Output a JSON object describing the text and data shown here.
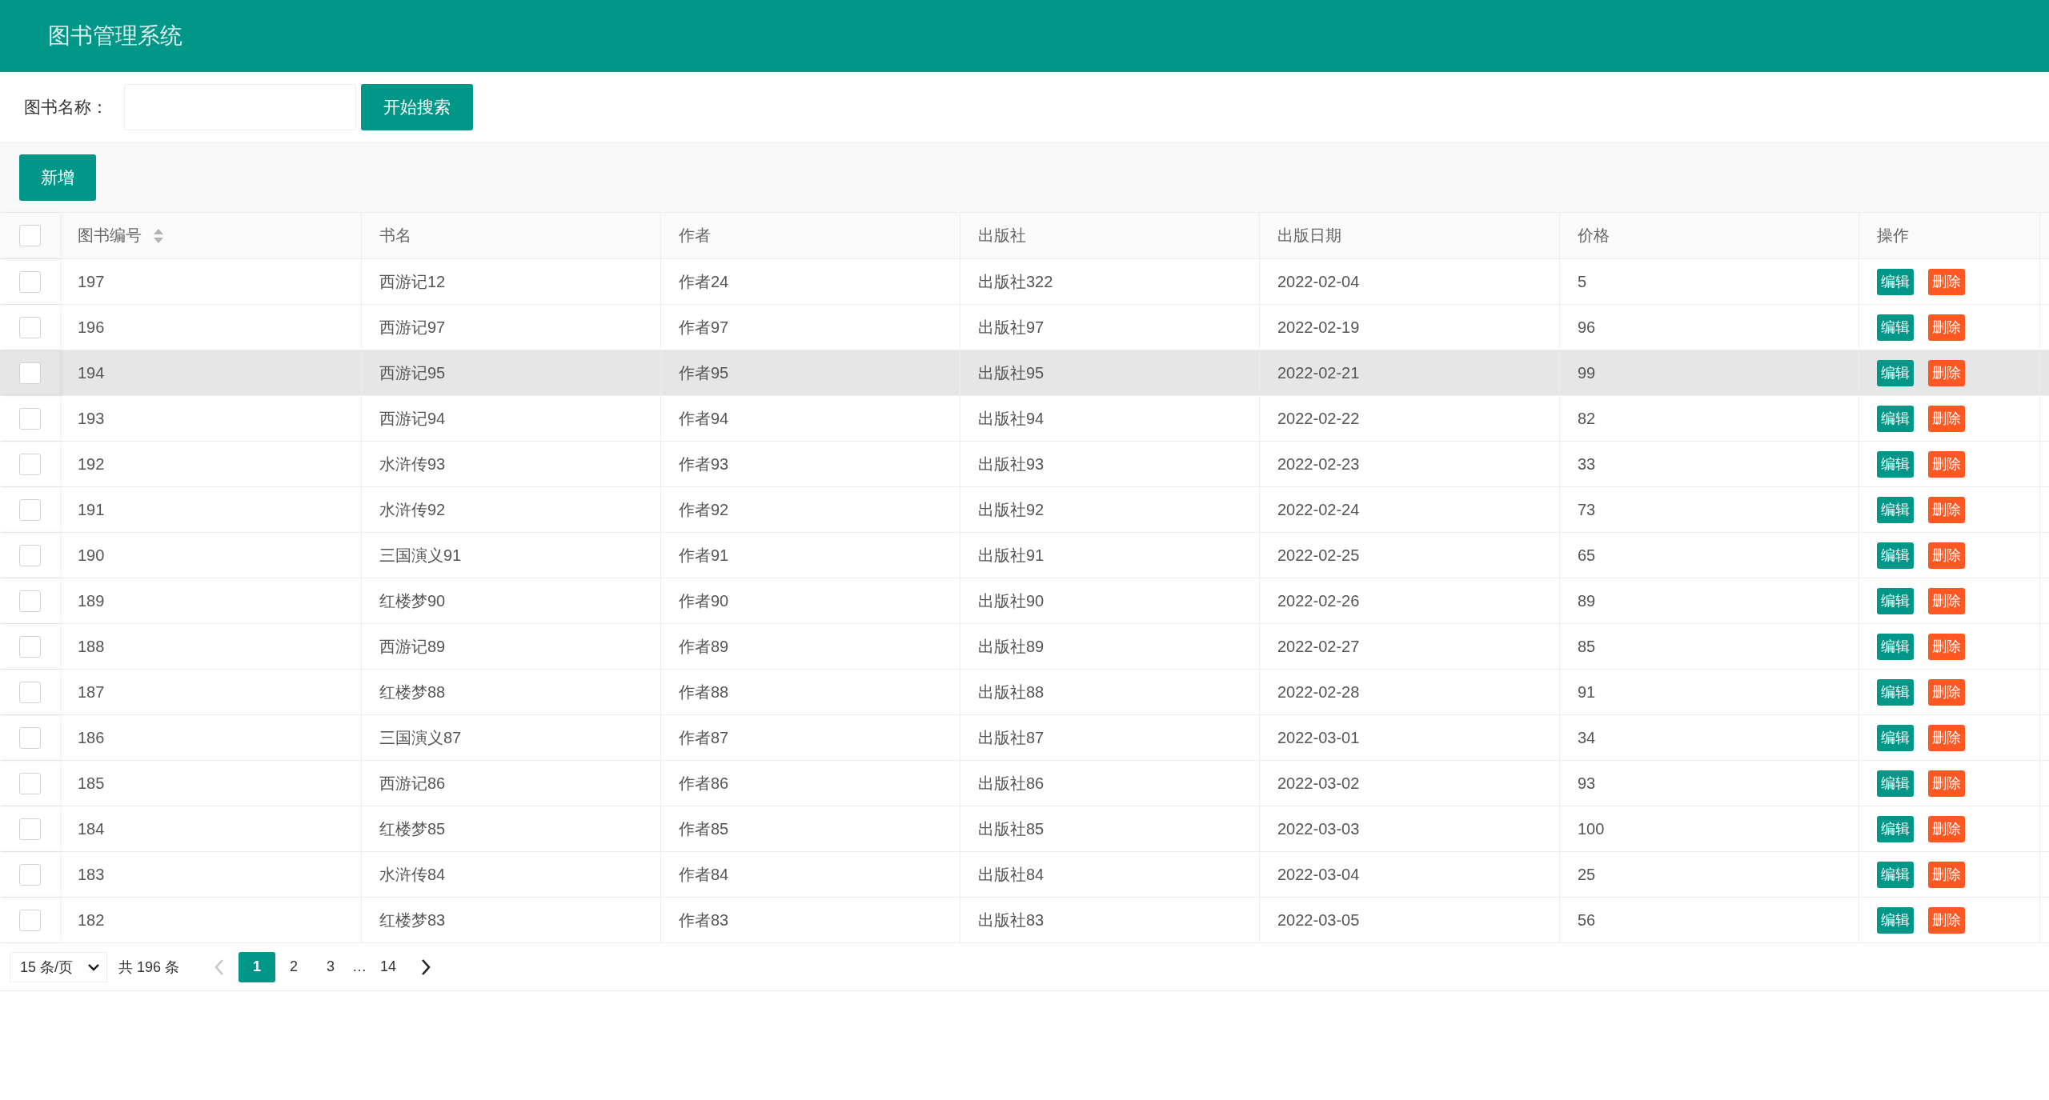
{
  "header": {
    "title": "图书管理系统"
  },
  "search": {
    "label": "图书名称：",
    "button": "开始搜索"
  },
  "toolbar": {
    "add_button": "新增"
  },
  "table": {
    "select_all_checked": false,
    "columns": [
      {
        "label": "图书编号",
        "sortable": true
      },
      {
        "label": "书名",
        "sortable": false
      },
      {
        "label": "作者",
        "sortable": false
      },
      {
        "label": "出版社",
        "sortable": false
      },
      {
        "label": "出版日期",
        "sortable": false
      },
      {
        "label": "价格",
        "sortable": false
      },
      {
        "label": "操作",
        "sortable": false
      }
    ],
    "rows": [
      {
        "checked": false,
        "highlighted": false,
        "cells": [
          "197",
          "西游记12",
          "作者24",
          "出版社322",
          "2022-02-04",
          "5"
        ],
        "actions": [
          "编辑",
          "删除"
        ]
      },
      {
        "checked": false,
        "highlighted": false,
        "cells": [
          "196",
          "西游记97",
          "作者97",
          "出版社97",
          "2022-02-19",
          "96"
        ],
        "actions": [
          "编辑",
          "删除"
        ]
      },
      {
        "checked": false,
        "highlighted": true,
        "cells": [
          "194",
          "西游记95",
          "作者95",
          "出版社95",
          "2022-02-21",
          "99"
        ],
        "actions": [
          "编辑",
          "删除"
        ]
      },
      {
        "checked": false,
        "highlighted": false,
        "cells": [
          "193",
          "西游记94",
          "作者94",
          "出版社94",
          "2022-02-22",
          "82"
        ],
        "actions": [
          "编辑",
          "删除"
        ]
      },
      {
        "checked": false,
        "highlighted": false,
        "cells": [
          "192",
          "水浒传93",
          "作者93",
          "出版社93",
          "2022-02-23",
          "33"
        ],
        "actions": [
          "编辑",
          "删除"
        ]
      },
      {
        "checked": false,
        "highlighted": false,
        "cells": [
          "191",
          "水浒传92",
          "作者92",
          "出版社92",
          "2022-02-24",
          "73"
        ],
        "actions": [
          "编辑",
          "删除"
        ]
      },
      {
        "checked": false,
        "highlighted": false,
        "cells": [
          "190",
          "三国演义91",
          "作者91",
          "出版社91",
          "2022-02-25",
          "65"
        ],
        "actions": [
          "编辑",
          "删除"
        ]
      },
      {
        "checked": false,
        "highlighted": false,
        "cells": [
          "189",
          "红楼梦90",
          "作者90",
          "出版社90",
          "2022-02-26",
          "89"
        ],
        "actions": [
          "编辑",
          "删除"
        ]
      },
      {
        "checked": false,
        "highlighted": false,
        "cells": [
          "188",
          "西游记89",
          "作者89",
          "出版社89",
          "2022-02-27",
          "85"
        ],
        "actions": [
          "编辑",
          "删除"
        ]
      },
      {
        "checked": false,
        "highlighted": false,
        "cells": [
          "187",
          "红楼梦88",
          "作者88",
          "出版社88",
          "2022-02-28",
          "91"
        ],
        "actions": [
          "编辑",
          "删除"
        ]
      },
      {
        "checked": false,
        "highlighted": false,
        "cells": [
          "186",
          "三国演义87",
          "作者87",
          "出版社87",
          "2022-03-01",
          "34"
        ],
        "actions": [
          "编辑",
          "删除"
        ]
      },
      {
        "checked": false,
        "highlighted": false,
        "cells": [
          "185",
          "西游记86",
          "作者86",
          "出版社86",
          "2022-03-02",
          "93"
        ],
        "actions": [
          "编辑",
          "删除"
        ]
      },
      {
        "checked": false,
        "highlighted": false,
        "cells": [
          "184",
          "红楼梦85",
          "作者85",
          "出版社85",
          "2022-03-03",
          "100"
        ],
        "actions": [
          "编辑",
          "删除"
        ]
      },
      {
        "checked": false,
        "highlighted": false,
        "cells": [
          "183",
          "水浒传84",
          "作者84",
          "出版社84",
          "2022-03-04",
          "25"
        ],
        "actions": [
          "编辑",
          "删除"
        ]
      },
      {
        "checked": false,
        "highlighted": false,
        "cells": [
          "182",
          "红楼梦83",
          "作者83",
          "出版社83",
          "2022-03-05",
          "56"
        ],
        "actions": [
          "编辑",
          "删除"
        ]
      }
    ]
  },
  "pagination": {
    "page_size": "15 条/页",
    "total": "共 196 条",
    "pages": [
      {
        "label": "1",
        "kind": "page",
        "selected": true
      },
      {
        "label": "2",
        "kind": "page",
        "selected": false
      },
      {
        "label": "3",
        "kind": "page",
        "selected": false
      },
      {
        "label": "…",
        "kind": "ellipsis"
      },
      {
        "label": "14",
        "kind": "page",
        "selected": false
      }
    ],
    "prev_disabled": true,
    "next_disabled": false
  }
}
